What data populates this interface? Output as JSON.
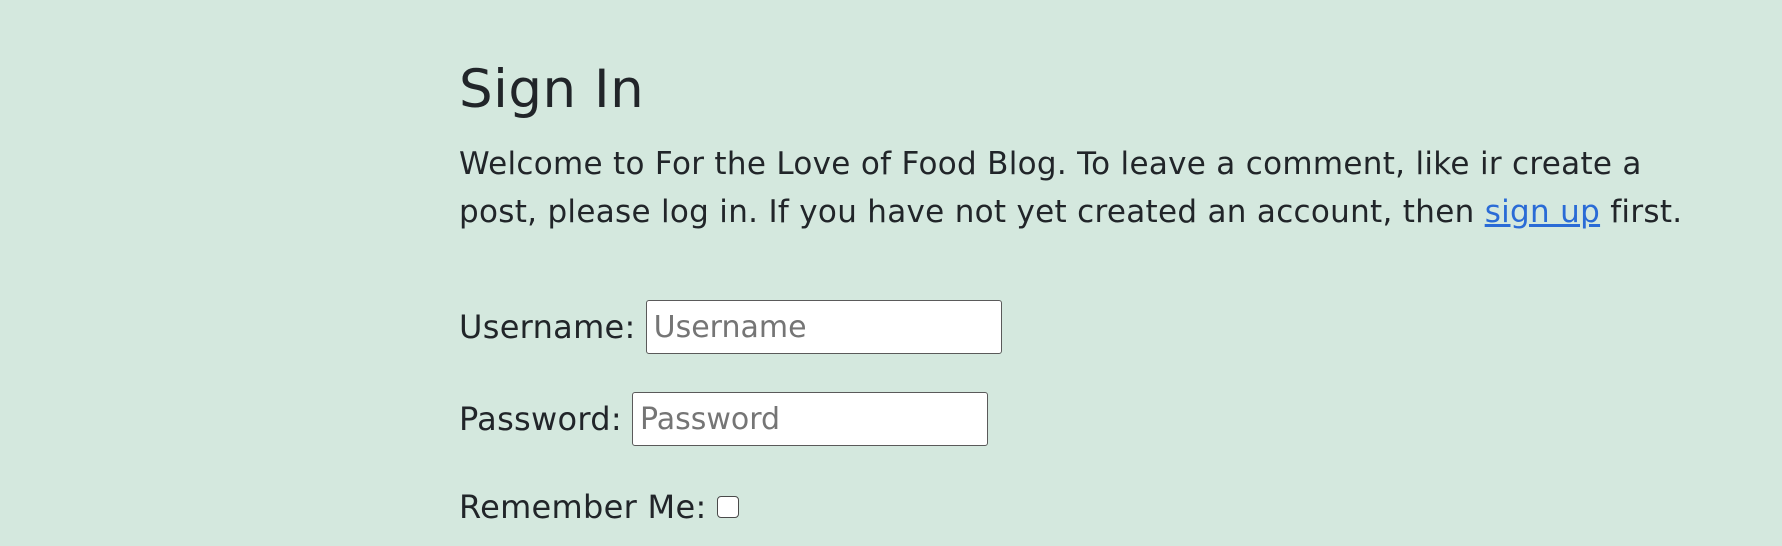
{
  "page": {
    "title": "Sign In",
    "intro_text_before_link": "Welcome to For the Love of Food Blog. To leave a comment, like ir create a post, please log in. If you have not yet created an account, then ",
    "signup_link_label": "sign up",
    "intro_text_after_link": " first."
  },
  "form": {
    "username": {
      "label": "Username:",
      "placeholder": "Username",
      "value": ""
    },
    "password": {
      "label": "Password:",
      "placeholder": "Password",
      "value": ""
    },
    "remember": {
      "label": "Remember Me:",
      "checked": false
    }
  },
  "colors": {
    "background": "#d4e8de",
    "link": "#2a6bd6",
    "text": "#212529"
  }
}
